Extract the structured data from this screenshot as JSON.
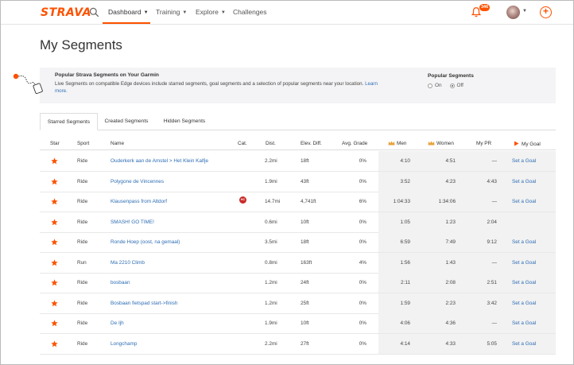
{
  "nav": {
    "logo": "STRAVA",
    "items": [
      {
        "label": "Dashboard",
        "has_chevron": true
      },
      {
        "label": "Training",
        "has_chevron": true
      },
      {
        "label": "Explore",
        "has_chevron": true
      },
      {
        "label": "Challenges",
        "has_chevron": false
      }
    ],
    "notification_count": "346"
  },
  "page_title": "My Segments",
  "banner": {
    "title": "Popular Strava Segments on Your Garmin",
    "description": "Live Segments on compatible Edge devices include starred segments, goal segments and a selection of popular segments near your location.",
    "learn_more": "Learn more.",
    "popular_label": "Popular Segments",
    "option_on": "On",
    "option_off": "Off",
    "selected": "Off"
  },
  "tabs": [
    "Starred Segments",
    "Created Segments",
    "Hidden Segments"
  ],
  "active_tab": "Starred Segments",
  "columns": {
    "star": "Star",
    "sport": "Sport",
    "name": "Name",
    "cat": "Cat.",
    "dist": "Dist.",
    "elev": "Elev. Diff.",
    "grade": "Avg. Grade",
    "men": "Men",
    "women": "Women",
    "pr": "My PR",
    "goal": "My Goal"
  },
  "rows": [
    {
      "sport": "Ride",
      "name": "Ouderkerk aan de Amstel > Het Klein Kalfje",
      "cat": "",
      "dist": "2.2mi",
      "elev": "18ft",
      "grade": "0%",
      "men": "4:10",
      "women": "4:51",
      "pr": "—",
      "goal": "Set a Goal"
    },
    {
      "sport": "Ride",
      "name": "Polygone de Vincennes",
      "cat": "",
      "dist": "1.9mi",
      "elev": "43ft",
      "grade": "0%",
      "men": "3:52",
      "women": "4:23",
      "pr": "4:43",
      "goal": "Set a Goal"
    },
    {
      "sport": "Ride",
      "name": "Klausenpass from Altdorf",
      "cat": "HC",
      "dist": "14.7mi",
      "elev": "4,741ft",
      "grade": "6%",
      "men": "1:04:33",
      "women": "1:34:06",
      "pr": "—",
      "goal": "Set a Goal"
    },
    {
      "sport": "Ride",
      "name": "SMASH! GO TIME!",
      "cat": "",
      "dist": "0.6mi",
      "elev": "10ft",
      "grade": "0%",
      "men": "1:05",
      "women": "1:23",
      "pr": "2:04",
      "goal": ""
    },
    {
      "sport": "Ride",
      "name": "Ronde Hoep (oost, na gemaal)",
      "cat": "",
      "dist": "3.5mi",
      "elev": "18ft",
      "grade": "0%",
      "men": "6:59",
      "women": "7:49",
      "pr": "9:12",
      "goal": "Set a Goal"
    },
    {
      "sport": "Run",
      "name": "Ma 2210 Climb",
      "cat": "",
      "dist": "0.8mi",
      "elev": "163ft",
      "grade": "4%",
      "men": "1:56",
      "women": "1:43",
      "pr": "—",
      "goal": "Set a Goal"
    },
    {
      "sport": "Ride",
      "name": "bosbaan",
      "cat": "",
      "dist": "1.2mi",
      "elev": "24ft",
      "grade": "0%",
      "men": "2:11",
      "women": "2:08",
      "pr": "2:51",
      "goal": "Set a Goal"
    },
    {
      "sport": "Ride",
      "name": "Bosbaan fietspad start->finish",
      "cat": "",
      "dist": "1.2mi",
      "elev": "25ft",
      "grade": "0%",
      "men": "1:59",
      "women": "2:23",
      "pr": "3:42",
      "goal": "Set a Goal"
    },
    {
      "sport": "Ride",
      "name": "De Ijh",
      "cat": "",
      "dist": "1.9mi",
      "elev": "10ft",
      "grade": "0%",
      "men": "4:06",
      "women": "4:36",
      "pr": "—",
      "goal": "Set a Goal"
    },
    {
      "sport": "Ride",
      "name": "Longchamp",
      "cat": "",
      "dist": "2.2mi",
      "elev": "27ft",
      "grade": "0%",
      "men": "4:14",
      "women": "4:33",
      "pr": "5:05",
      "goal": "Set a Goal"
    }
  ],
  "colors": {
    "brand": "#fc5200",
    "link": "#2f6eb5",
    "cat_hc": "#c92a2a"
  }
}
